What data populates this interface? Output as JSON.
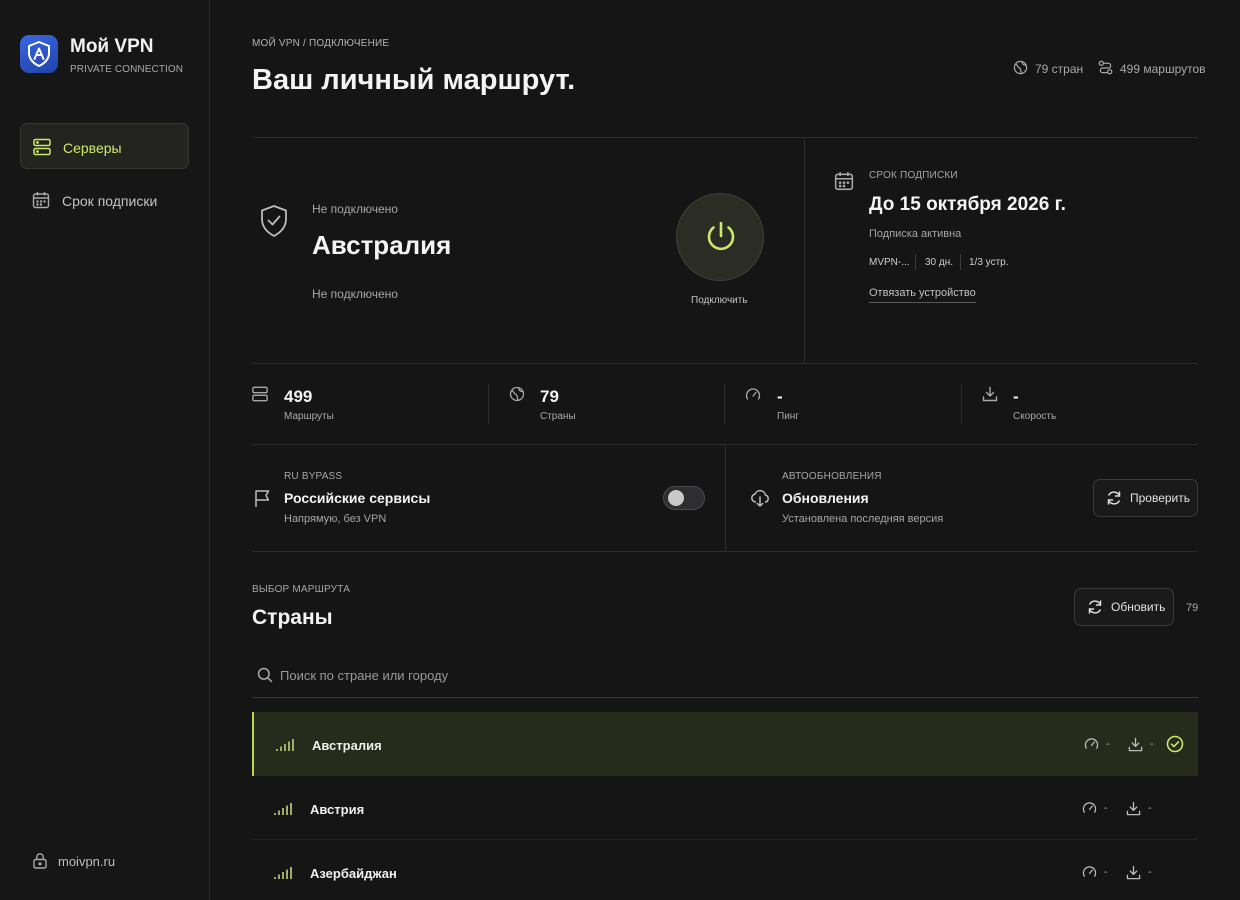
{
  "sidebar": {
    "app_name": "Мой VPN",
    "app_subtitle": "PRIVATE CONNECTION",
    "nav": [
      {
        "label": "Серверы",
        "icon": "server-icon",
        "active": true
      },
      {
        "label": "Срок подписки",
        "icon": "calendar-icon",
        "active": false
      }
    ],
    "footer_link": "moivpn.ru"
  },
  "header": {
    "breadcrumb": "МОЙ VPN / ПОДКЛЮЧЕНИЕ",
    "title": "Ваш личный маршрут.",
    "countries_stat": "79 стран",
    "routes_stat": "499 маршрутов"
  },
  "connection": {
    "status_top": "Не подключено",
    "location": "Австралия",
    "status_bottom": "Не подключено",
    "connect_label": "Подключить"
  },
  "subscription": {
    "caption": "СРОК ПОДПИСКИ",
    "until": "До 15 октября 2026 г.",
    "status": "Подписка активна",
    "plan": "MVPN-...",
    "days": "30 дн.",
    "devices": "1/3 устр.",
    "unbind_label": "Отвязать устройство"
  },
  "stats": [
    {
      "value": "499",
      "label": "Маршруты",
      "icon": "server-icon"
    },
    {
      "value": "79",
      "label": "Страны",
      "icon": "globe-icon"
    },
    {
      "value": "-",
      "label": "Пинг",
      "icon": "speedometer-icon"
    },
    {
      "value": "-",
      "label": "Скорость",
      "icon": "download-icon"
    }
  ],
  "bypass": {
    "caption": "RU BYPASS",
    "title": "Российские сервисы",
    "subtitle": "Напрямую, без VPN",
    "enabled": false
  },
  "updates": {
    "caption": "АВТООБНОВЛЕНИЯ",
    "title": "Обновления",
    "subtitle": "Установлена последняя версия",
    "check_label": "Проверить"
  },
  "route_select": {
    "caption": "ВЫБОР МАРШРУТА",
    "title": "Страны",
    "refresh_label": "Обновить",
    "count": "79",
    "search_placeholder": "Поиск по стране или городу"
  },
  "countries": [
    {
      "name": "Австралия",
      "ping": "-",
      "speed": "-",
      "selected": true
    },
    {
      "name": "Австрия",
      "ping": "-",
      "speed": "-",
      "selected": false
    },
    {
      "name": "Азербайджан",
      "ping": "-",
      "speed": "-",
      "selected": false
    }
  ],
  "colors": {
    "accent": "#cfe86a",
    "background": "#151516",
    "logo": "#2f5bd6",
    "selected_row": "#262b1c"
  }
}
